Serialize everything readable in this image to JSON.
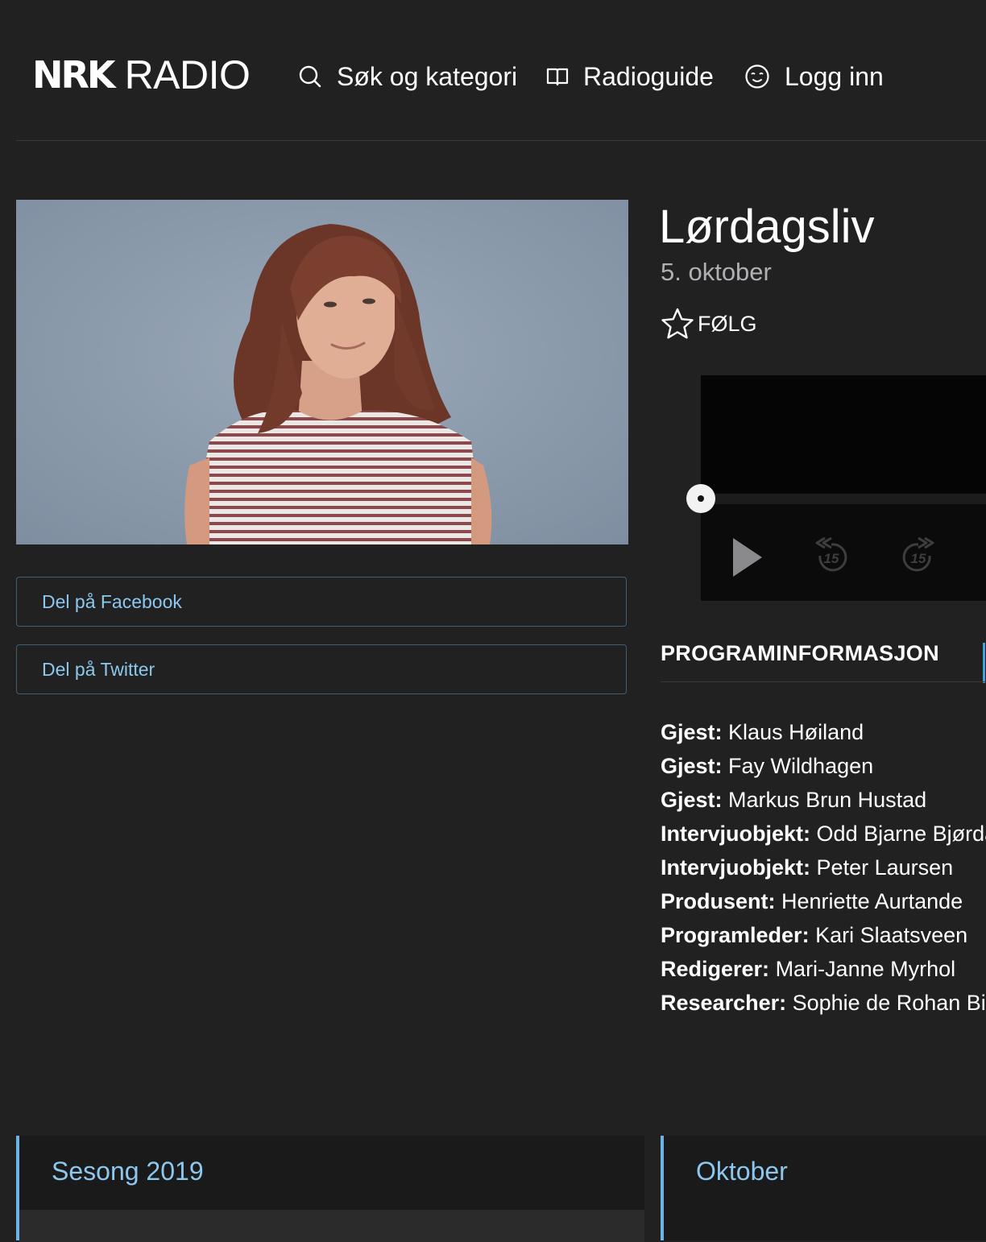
{
  "header": {
    "logo_mark": "NRK",
    "logo_text": "RADIO",
    "nav": [
      {
        "label": "Søk og kategori",
        "icon": "search-icon"
      },
      {
        "label": "Radioguide",
        "icon": "book-icon"
      },
      {
        "label": "Logg inn",
        "icon": "user-face-icon"
      }
    ]
  },
  "hero": {
    "image": "presenter-photo"
  },
  "share": {
    "facebook": "Del på Facebook",
    "twitter": "Del på Twitter"
  },
  "episode": {
    "title": "Lørdagsliv",
    "date": "5. oktober",
    "follow_label": "FØLG"
  },
  "player": {
    "progress": 0,
    "rewind_seconds": "15",
    "forward_seconds": "15"
  },
  "info": {
    "tab_label": "PROGRAMINFORMASJON",
    "credits": [
      {
        "role": "Gjest:",
        "name": "Klaus Høiland"
      },
      {
        "role": "Gjest:",
        "name": "Fay Wildhagen"
      },
      {
        "role": "Gjest:",
        "name": "Markus Brun Hustad"
      },
      {
        "role": "Intervjuobjekt:",
        "name": "Odd Bjarne Bjørdal"
      },
      {
        "role": "Intervjuobjekt:",
        "name": "Peter Laursen"
      },
      {
        "role": "Produsent:",
        "name": "Henriette Aurtande"
      },
      {
        "role": "Programleder:",
        "name": "Kari Slaatsveen"
      },
      {
        "role": "Redigerer:",
        "name": "Mari-Janne Myrhol"
      },
      {
        "role": "Researcher:",
        "name": "Sophie de Rohan Bir"
      }
    ]
  },
  "seasons": {
    "season_label": "Sesong 2019",
    "month_label": "Oktober"
  },
  "colors": {
    "background": "#212122",
    "accent": "#8cc8ee",
    "accent_border": "#6cb4e6"
  }
}
